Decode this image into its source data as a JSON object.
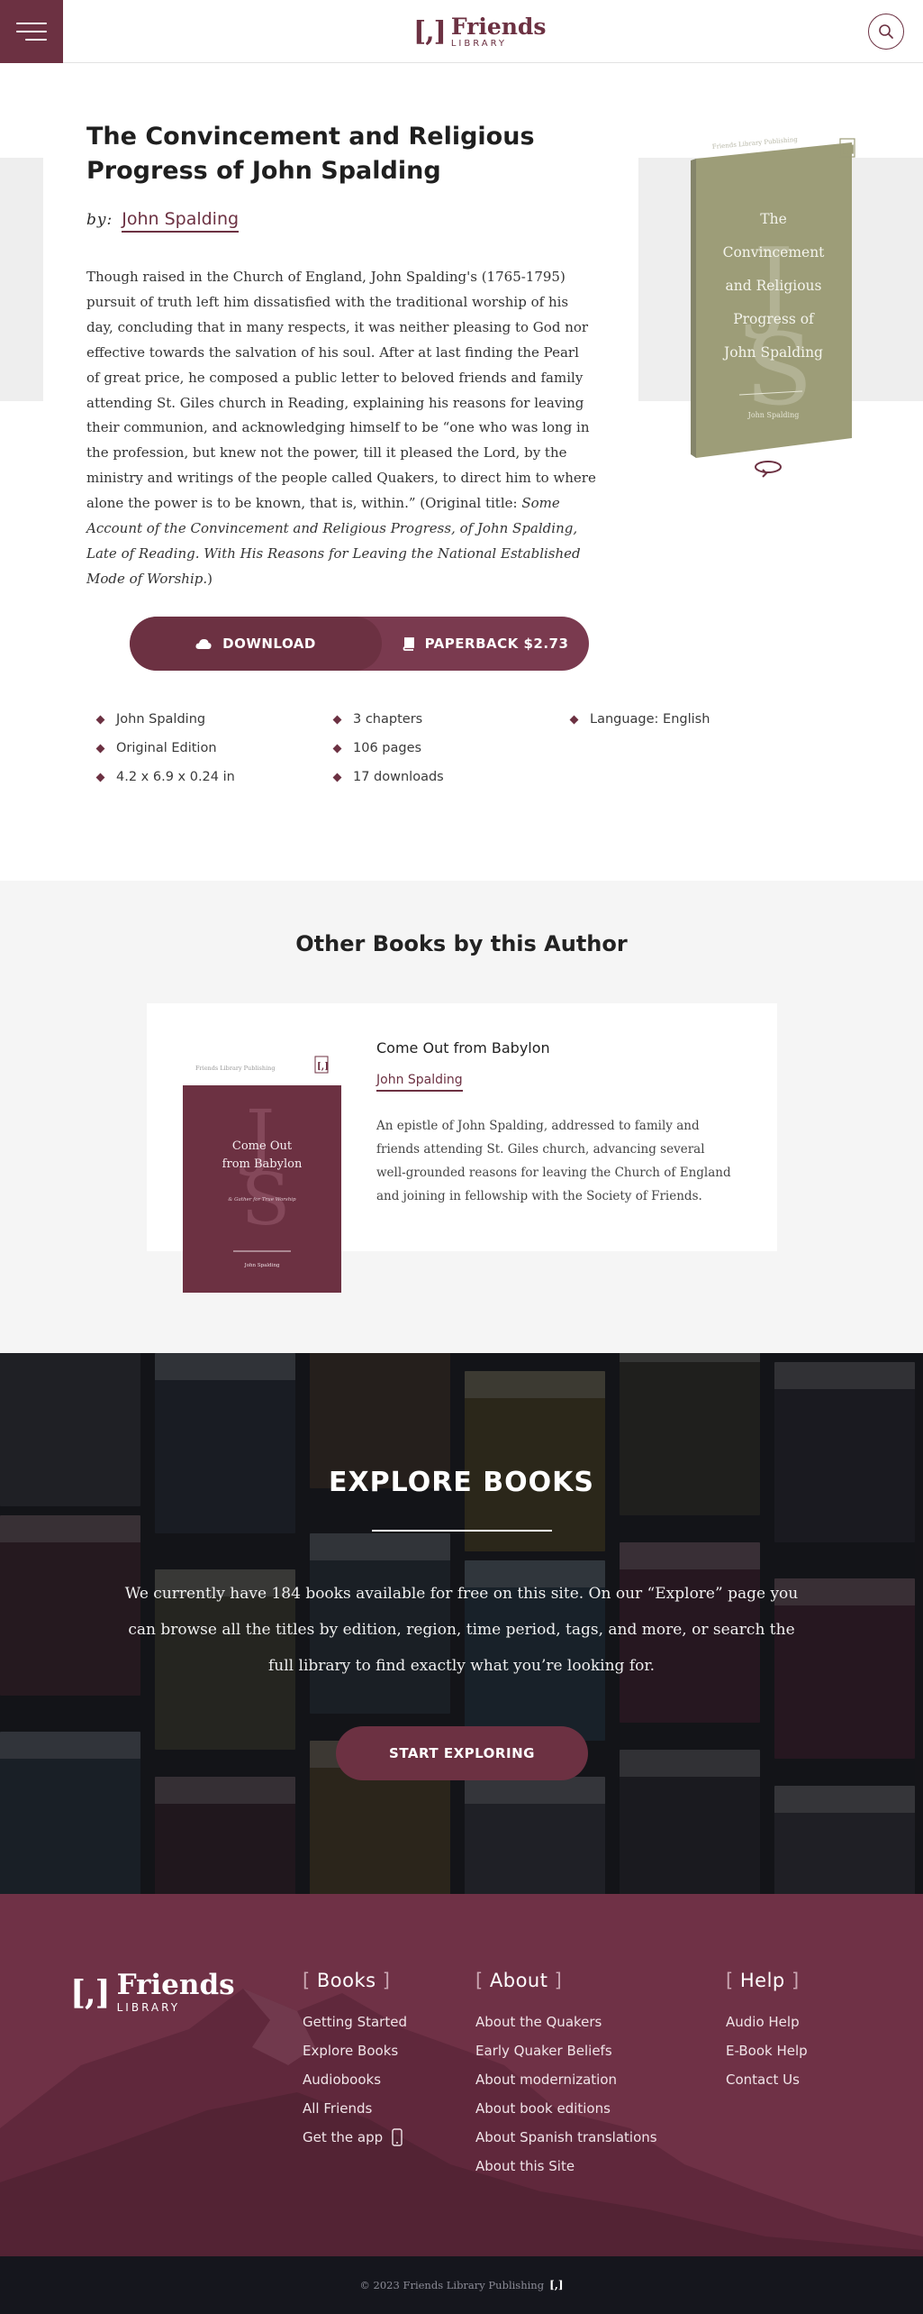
{
  "header": {
    "logo_bracket": "[,]",
    "logo_text": "Friends",
    "logo_sub": "LIBRARY"
  },
  "book": {
    "title": "The Convincement and Religious Progress of John Spalding",
    "by_label": "by:",
    "author": "John Spalding",
    "description_main": "Though raised in the Church of England, John Spalding's (1765-1795) pursuit of truth left him dissatisfied with the traditional worship of his day, concluding that in many respects, it was neither pleasing to God nor effective towards the salvation of his soul. After at last finding the Pearl of great price, he composed a public letter to beloved friends and family attending St. Giles church in Reading, explaining his reasons for leaving their communion, and acknowledging himself to be “one who was long in the profession, but knew not the power, till it pleased the Lord, by the ministry and writings of the people called Quakers, to direct him to where alone the power is to be known, that is, within.” (Original title: ",
    "description_italic": "Some Account of the Convincement and Religious Progress, of John Spalding, Late of Reading. With His Reasons for Leaving the National Established Mode of Worship.",
    "description_end": ")",
    "cover": {
      "publisher": "Friends Library Publishing",
      "bracket": "[,]",
      "monogram_1": "J",
      "monogram_2": "S",
      "title_lines": [
        "The",
        "Convincement",
        "and Religious",
        "Progress of",
        "John Spalding"
      ],
      "author": "John Spalding",
      "color": "#9d9d78"
    }
  },
  "actions": {
    "download_label": "DOWNLOAD",
    "paperback_label": "PAPERBACK $2.73"
  },
  "meta": [
    "John Spalding",
    "3 chapters",
    "Language: English",
    "Original Edition",
    "106 pages",
    "",
    "4.2 x 6.9 x 0.24 in",
    "17 downloads",
    ""
  ],
  "other_books": {
    "heading": "Other Books by this Author",
    "items": [
      {
        "title": "Come Out from Babylon",
        "author": "John Spalding",
        "description": "An epistle of John Spalding, addressed to family and friends attending St. Giles church, advancing several well-grounded reasons for leaving the Church of England and joining in fellowship with the Society of Friends.",
        "cover_publisher": "Friends Library Publishing",
        "cover_bracket": "[,]",
        "cover_title_1": "Come Out",
        "cover_title_2": "from Babylon",
        "cover_subtitle": "& Gather for True Worship",
        "cover_author": "John Spalding",
        "cover_monogram_1": "J",
        "cover_monogram_2": "S",
        "cover_color": "#6c3142"
      }
    ]
  },
  "explore": {
    "title": "EXPLORE BOOKS",
    "text": "We currently have 184 books available for free on this site. On our “Explore” page you can browse all the titles by edition, region, time period, tags, and more, or search the full library to find exactly what you’re looking for.",
    "button": "START EXPLORING"
  },
  "footer": {
    "logo_bracket": "[,]",
    "logo_text": "Friends",
    "logo_sub": "LIBRARY",
    "columns": [
      {
        "title": "Books",
        "links": [
          "Getting Started",
          "Explore Books",
          "Audiobooks",
          "All Friends",
          "Get the app"
        ]
      },
      {
        "title": "About",
        "links": [
          "About the Quakers",
          "Early Quaker Beliefs",
          "About modernization",
          "About book editions",
          "About Spanish translations",
          "About this Site"
        ]
      },
      {
        "title": "Help",
        "links": [
          "Audio Help",
          "E-Book Help",
          "Contact Us"
        ]
      }
    ],
    "copyright": "© 2023 Friends Library Publishing",
    "copyright_mark": "[,]"
  },
  "colors": {
    "brand": "#6c3142",
    "cover_olive": "#9d9d78",
    "footer_dark": "#15161d"
  }
}
